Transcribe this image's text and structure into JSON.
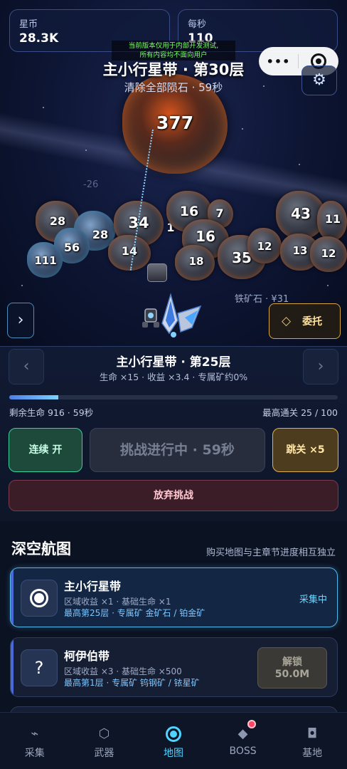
{
  "stats": {
    "coins_label": "星币",
    "coins_value": "28.3K",
    "per_sec_label": "每秒",
    "per_sec_value": "110"
  },
  "notice": {
    "line1": "当前版本仅用于内部开发测试,",
    "line2": "所有内容均不面向用户"
  },
  "capsule": {
    "more": "•••"
  },
  "scene": {
    "floor_title": "主小行星带 · 第30层",
    "floor_subtitle": "清除全部陨石 · 59秒",
    "boss_hp": "377",
    "damage_float": "-26",
    "ore_tag": "铁矿石 · ¥31",
    "rocks": [
      "28",
      "28",
      "56",
      "111",
      "34",
      "14",
      "1",
      "16",
      "7",
      "16",
      "18",
      "35",
      "12",
      "43",
      "11",
      "13",
      "12"
    ]
  },
  "buttons": {
    "side_arrow": "›",
    "task_label": "委托",
    "task_icon": "◇"
  },
  "level": {
    "prev_arrow": "‹",
    "next_arrow": "›",
    "title": "主小行星带 · 第25层",
    "subtitle": "生命 ×15 · 收益 ×3.4 · 专属矿约0%",
    "progress": 0.15,
    "remaining": "剩余生命 916 · 59秒",
    "best": "最高通关 25 / 100"
  },
  "actions": {
    "continuous": "连续 开",
    "challenge": "挑战进行中 · 59秒",
    "skip": "跳关 ×5",
    "abandon": "放弃挑战"
  },
  "map_section": {
    "title": "深空航图",
    "note": "购买地图与主章节进度相互独立",
    "cards": [
      {
        "name": "主小行星带",
        "line2": "区域收益 ×1 · 基础生命 ×1",
        "line3": "最高第25层 · 专属矿 金矿石 / 铂金矿",
        "status": "采集中"
      },
      {
        "icon": "?",
        "name": "柯伊伯带",
        "line2": "区域收益 ×3 · 基础生命 ×500",
        "line3": "最高第1层 · 专属矿 钨钢矿 / 铱星矿",
        "unlock_label": "解锁",
        "unlock_cost": "50.0M"
      }
    ]
  },
  "tabs": [
    {
      "label": "采集",
      "icon": "⌁"
    },
    {
      "label": "武器",
      "icon": "⬡"
    },
    {
      "label": "地图",
      "icon": "target"
    },
    {
      "label": "BOSS",
      "icon": "◆"
    },
    {
      "label": "基地",
      "icon": "◘"
    }
  ],
  "colors": {
    "accent": "#4fd3ff",
    "continuous": "#3bd19a",
    "skip": "#e1b24b",
    "abandon": "#7c3a4b"
  }
}
